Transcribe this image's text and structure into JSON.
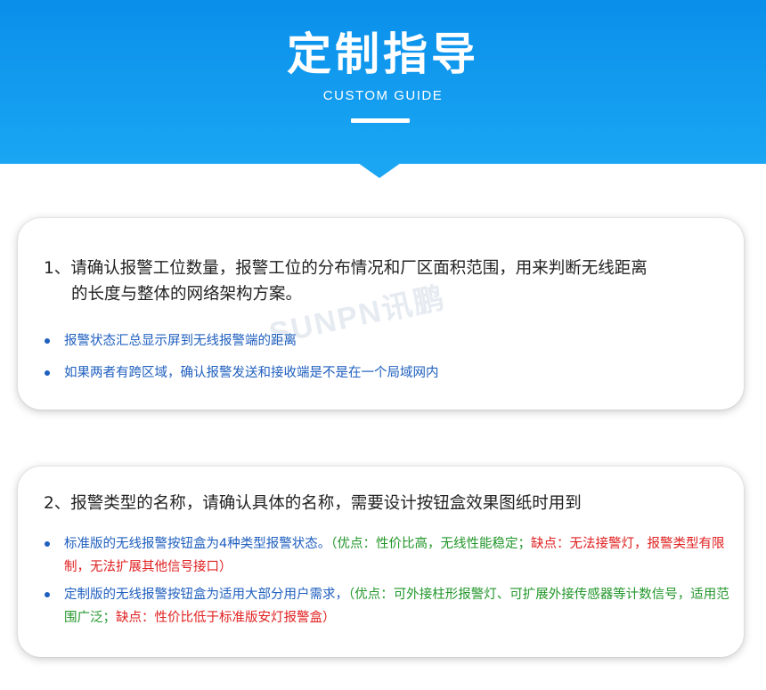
{
  "header": {
    "title": "定制指导",
    "subtitle": "CUSTOM GUIDE"
  },
  "watermark": "SUNPN讯鹏",
  "section1": {
    "heading_line1": "1、请确认报警工位数量，报警工位的分布情况和厂区面积范围，用来判断无线距离",
    "heading_line2": "的长度与整体的网络架构方案。",
    "bullets": [
      "报警状态汇总显示屏到无线报警端的距离",
      "如果两者有跨区域，确认报警发送和接收端是不是在一个局域网内"
    ]
  },
  "section2": {
    "heading": "2、报警类型的名称，请确认具体的名称，需要设计按钮盒效果图纸时用到",
    "bullet1": {
      "main": "标准版的无线报警按钮盒为4种类型报警状态。",
      "pros": "（优点：性价比高，无线性能稳定；",
      "cons": "缺点：无法接警灯，报警类型有限制，无法扩展其他信号接口）"
    },
    "bullet2": {
      "main": "定制版的无线报警按钮盒为适用大部分用户需求，",
      "pros": "（优点：可外接柱形报警灯、可扩展外接传感器等计数信号，适用范围广泛；",
      "cons": "缺点：性价比低于标准版安灯报警盒）"
    }
  },
  "colors": {
    "banner": "#1aa6f3",
    "bullet_blue": "#1f5fbf",
    "pros_green": "#22962a",
    "cons_red": "#e02020"
  }
}
